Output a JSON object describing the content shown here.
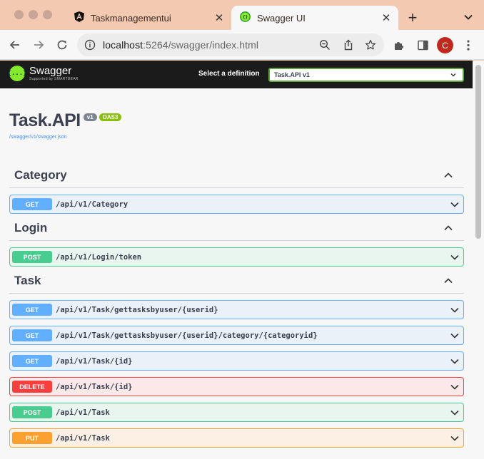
{
  "browser": {
    "tabs": [
      {
        "title": "Taskmanagementui",
        "active": false,
        "icon": "angular-icon"
      },
      {
        "title": "Swagger UI",
        "active": true,
        "icon": "swagger-icon"
      }
    ],
    "new_tab_symbol": "+",
    "close_symbol": "✕",
    "url_host": "localhost",
    "url_rest": ":5264/swagger/index.html",
    "profile_initial": "C",
    "accent_color": "#c0291d"
  },
  "swagger": {
    "logo_name": "Swagger",
    "logo_sub": "Supported by SMARTBEAR",
    "logo_symbol": "{...}",
    "definition_label": "Select a definition",
    "definition_value": "Task.API v1",
    "title": "Task.API",
    "version_badge": "v1",
    "oas_badge": "OAS3",
    "spec_link": "/swagger/v1/swagger.json"
  },
  "sections": [
    {
      "name": "Category",
      "operations": [
        {
          "method": "GET",
          "path": "/api/v1/Category"
        }
      ]
    },
    {
      "name": "Login",
      "operations": [
        {
          "method": "POST",
          "path": "/api/v1/Login/token"
        }
      ]
    },
    {
      "name": "Task",
      "operations": [
        {
          "method": "GET",
          "path": "/api/v1/Task/gettasksbyuser/{userid}"
        },
        {
          "method": "GET",
          "path": "/api/v1/Task/gettasksbyuser/{userid}/category/{categoryid}"
        },
        {
          "method": "GET",
          "path": "/api/v1/Task/{id}"
        },
        {
          "method": "DELETE",
          "path": "/api/v1/Task/{id}"
        },
        {
          "method": "POST",
          "path": "/api/v1/Task"
        },
        {
          "method": "PUT",
          "path": "/api/v1/Task"
        }
      ]
    }
  ],
  "method_colors": {
    "GET": "#61affe",
    "POST": "#49cc90",
    "DELETE": "#f93e3e",
    "PUT": "#fca130"
  }
}
